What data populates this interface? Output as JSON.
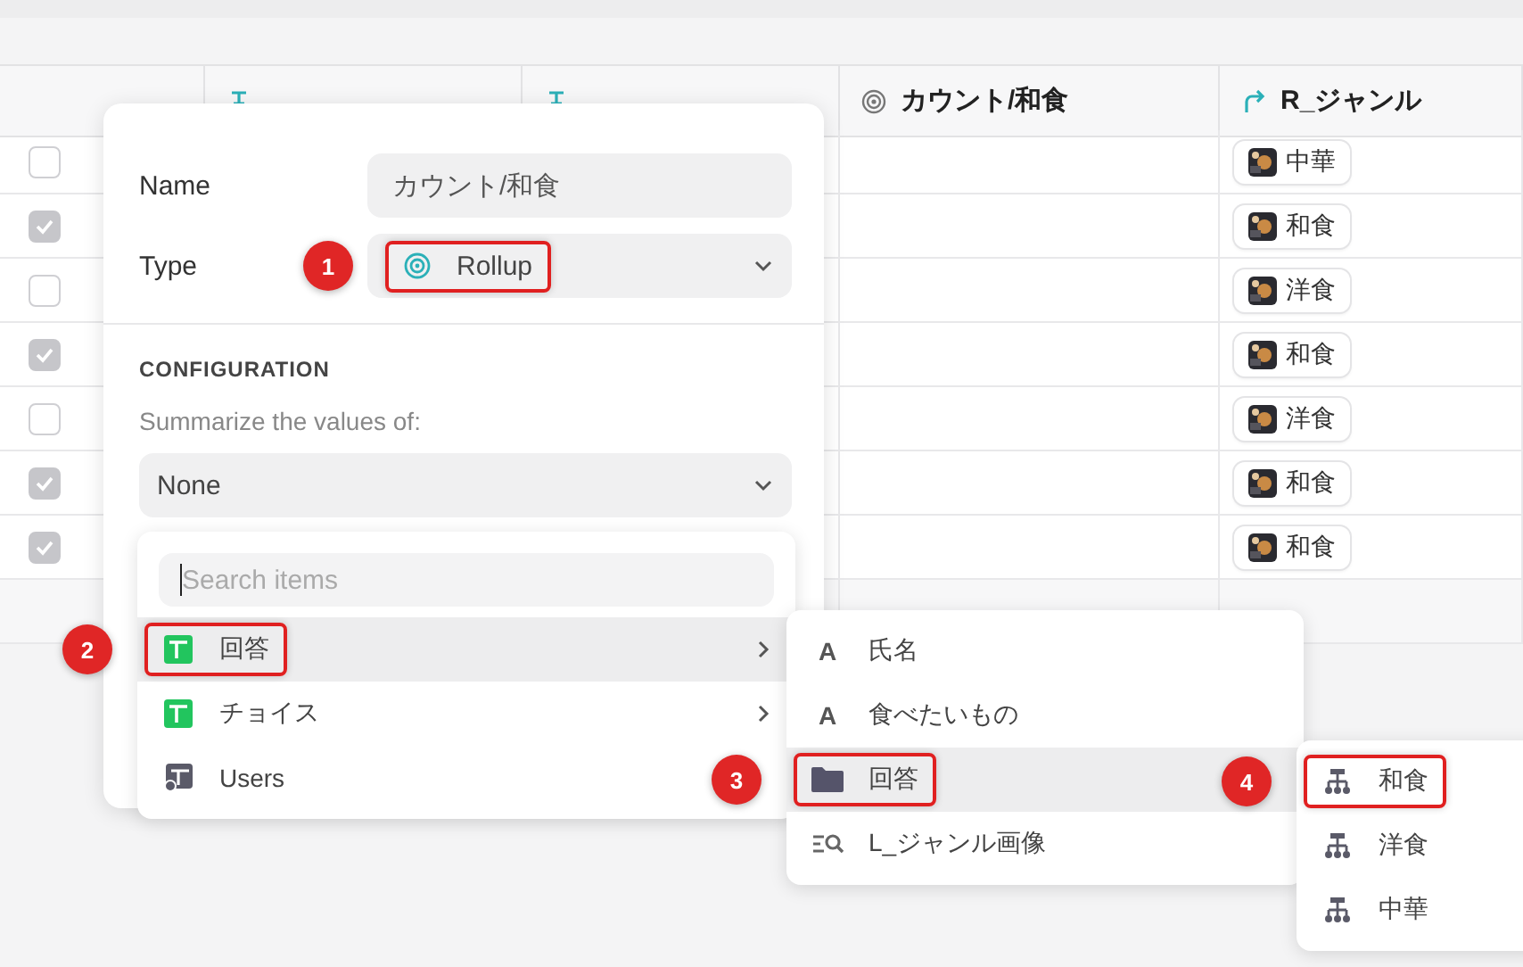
{
  "table": {
    "columns": [
      {
        "kind": "lookup"
      },
      {
        "kind": "lookup"
      },
      {
        "label": "カウント/和食",
        "kind": "rollup"
      },
      {
        "label": "R_ジャンル",
        "kind": "link"
      }
    ],
    "rows": [
      {
        "checked": false,
        "genre": "中華"
      },
      {
        "checked": true,
        "genre": "和食"
      },
      {
        "checked": false,
        "genre": "洋食"
      },
      {
        "checked": true,
        "genre": "和食"
      },
      {
        "checked": false,
        "genre": "洋食"
      },
      {
        "checked": true,
        "genre": "和食"
      },
      {
        "checked": true,
        "genre": "和食"
      }
    ]
  },
  "popover": {
    "name_label": "Name",
    "name_value": "カウント/和食",
    "type_label": "Type",
    "type_value": "Rollup",
    "type_callout": "1",
    "section": "CONFIGURATION",
    "summarize_label": "Summarize the values of:",
    "summarize_value": "None"
  },
  "menu": {
    "search_placeholder": "Search items",
    "items": [
      {
        "label": "回答",
        "kind": "table",
        "selected": true,
        "submenu": true,
        "callout": "2"
      },
      {
        "label": "チョイス",
        "kind": "table",
        "selected": false,
        "submenu": true
      },
      {
        "label": "Users",
        "kind": "users",
        "selected": false,
        "submenu": false
      }
    ]
  },
  "submenu": {
    "items": [
      {
        "label": "氏名",
        "kind": "text",
        "icon_char": "A",
        "selected": false
      },
      {
        "label": "食べたいもの",
        "kind": "text",
        "icon_char": "A",
        "selected": false
      },
      {
        "label": "回答",
        "kind": "folder",
        "selected": true,
        "callout": "3"
      },
      {
        "label": "L_ジャンル画像",
        "kind": "lookup",
        "selected": false
      }
    ]
  },
  "submenu2": {
    "items": [
      {
        "label": "和食",
        "kind": "hierarchy",
        "selected": false,
        "callout": "4"
      },
      {
        "label": "洋食",
        "kind": "hierarchy",
        "selected": false
      },
      {
        "label": "中華",
        "kind": "hierarchy",
        "selected": false
      }
    ]
  }
}
